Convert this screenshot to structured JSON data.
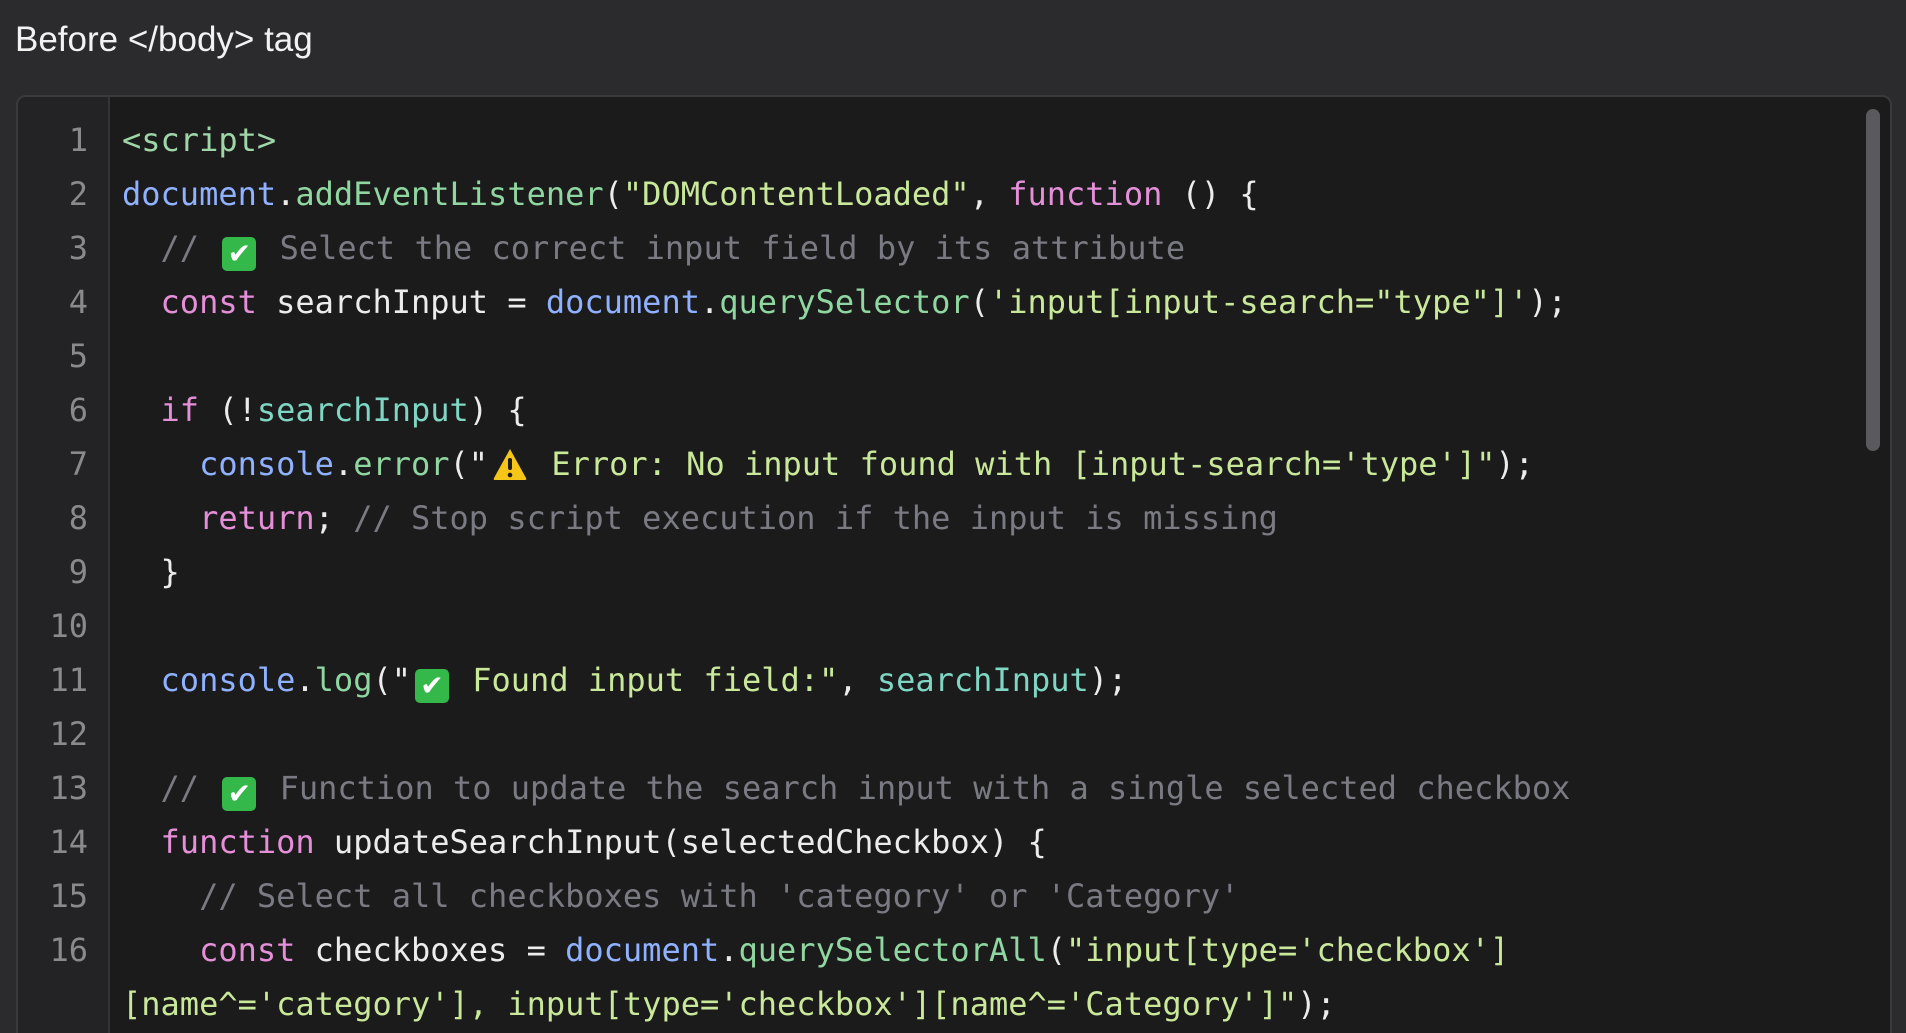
{
  "panel": {
    "title": "Before </body> tag"
  },
  "editor": {
    "line_numbers": [
      "1",
      "2",
      "3",
      "4",
      "5",
      "6",
      "7",
      "8",
      "9",
      "10",
      "11",
      "12",
      "13",
      "14",
      "15",
      "16"
    ],
    "lines": [
      [
        {
          "t": "<script>",
          "c": "tag"
        }
      ],
      [
        {
          "t": "document",
          "c": "obj"
        },
        {
          "t": ".",
          "c": "punct"
        },
        {
          "t": "addEventListener",
          "c": "method"
        },
        {
          "t": "(",
          "c": "punct"
        },
        {
          "t": "\"DOMContentLoaded\"",
          "c": "string"
        },
        {
          "t": ", ",
          "c": "punct"
        },
        {
          "t": "function",
          "c": "keyword"
        },
        {
          "t": " () {",
          "c": "punct"
        }
      ],
      [
        {
          "t": "  // ",
          "c": "comment"
        },
        {
          "icon": "check-mark-emoji-icon"
        },
        {
          "t": " Select the correct input field by its attribute",
          "c": "comment"
        }
      ],
      [
        {
          "t": "  ",
          "c": "plain"
        },
        {
          "t": "const",
          "c": "keyword"
        },
        {
          "t": " searchInput = ",
          "c": "plain"
        },
        {
          "t": "document",
          "c": "obj"
        },
        {
          "t": ".",
          "c": "punct"
        },
        {
          "t": "querySelector",
          "c": "method"
        },
        {
          "t": "(",
          "c": "punct"
        },
        {
          "t": "'input[input-search=\"type\"]'",
          "c": "string"
        },
        {
          "t": ");",
          "c": "punct"
        }
      ],
      [],
      [
        {
          "t": "  ",
          "c": "plain"
        },
        {
          "t": "if",
          "c": "keyword"
        },
        {
          "t": " (!",
          "c": "punct"
        },
        {
          "t": "searchInput",
          "c": "var"
        },
        {
          "t": ") {",
          "c": "punct"
        }
      ],
      [
        {
          "t": "    ",
          "c": "plain"
        },
        {
          "t": "console",
          "c": "obj"
        },
        {
          "t": ".",
          "c": "punct"
        },
        {
          "t": "error",
          "c": "method"
        },
        {
          "t": "(\"",
          "c": "punct"
        },
        {
          "icon": "warning-emoji-icon"
        },
        {
          "t": " Error: No input found with [input-search='type']\"",
          "c": "string"
        },
        {
          "t": ");",
          "c": "punct"
        }
      ],
      [
        {
          "t": "    ",
          "c": "plain"
        },
        {
          "t": "return",
          "c": "keyword"
        },
        {
          "t": "; ",
          "c": "punct"
        },
        {
          "t": "// Stop script execution if the input is missing",
          "c": "comment"
        }
      ],
      [
        {
          "t": "  }",
          "c": "punct"
        }
      ],
      [],
      [
        {
          "t": "  ",
          "c": "plain"
        },
        {
          "t": "console",
          "c": "obj"
        },
        {
          "t": ".",
          "c": "punct"
        },
        {
          "t": "log",
          "c": "method"
        },
        {
          "t": "(\"",
          "c": "punct"
        },
        {
          "icon": "check-mark-emoji-icon"
        },
        {
          "t": " Found input field:\"",
          "c": "string"
        },
        {
          "t": ", ",
          "c": "punct"
        },
        {
          "t": "searchInput",
          "c": "var"
        },
        {
          "t": ");",
          "c": "punct"
        }
      ],
      [],
      [
        {
          "t": "  // ",
          "c": "comment"
        },
        {
          "icon": "check-mark-emoji-icon"
        },
        {
          "t": " Function to update the search input with a single selected checkbox",
          "c": "comment"
        }
      ],
      [
        {
          "t": "  ",
          "c": "plain"
        },
        {
          "t": "function",
          "c": "keyword"
        },
        {
          "t": " updateSearchInput(selectedCheckbox) {",
          "c": "plain"
        }
      ],
      [
        {
          "t": "    // Select all checkboxes with 'category' or 'Category'",
          "c": "comment"
        }
      ],
      [
        {
          "t": "    ",
          "c": "plain"
        },
        {
          "t": "const",
          "c": "keyword"
        },
        {
          "t": " checkboxes = ",
          "c": "plain"
        },
        {
          "t": "document",
          "c": "obj"
        },
        {
          "t": ".",
          "c": "punct"
        },
        {
          "t": "querySelectorAll",
          "c": "method"
        },
        {
          "t": "(",
          "c": "punct"
        },
        {
          "t": "\"input[type='checkbox']",
          "c": "string"
        }
      ],
      [
        {
          "t": "[name^='category'], input[type='checkbox'][name^='Category']\"",
          "c": "string"
        },
        {
          "t": ");",
          "c": "punct"
        }
      ]
    ]
  }
}
